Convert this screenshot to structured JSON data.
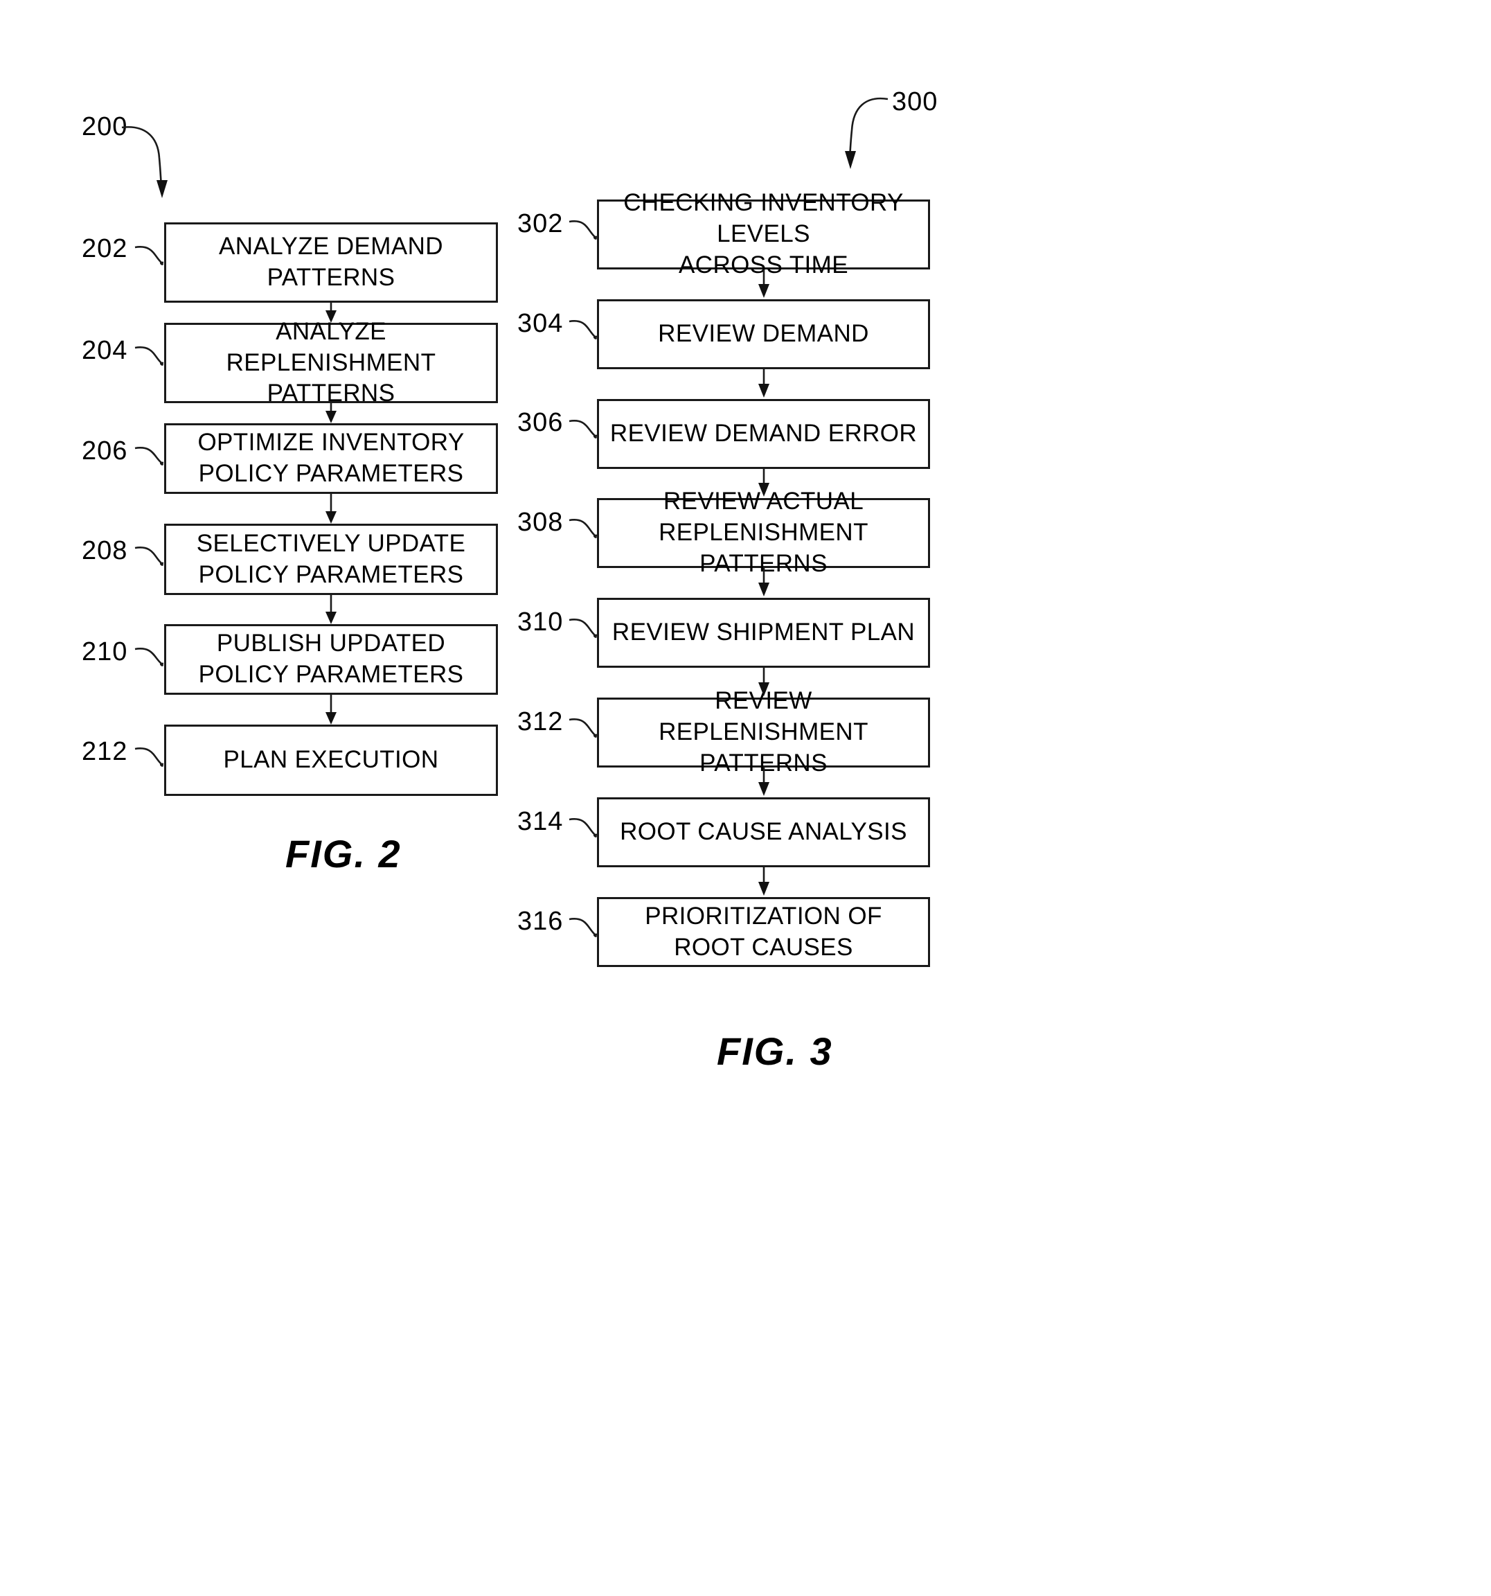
{
  "figures": [
    {
      "id": "fig2",
      "caption": "FIG. 2",
      "flow_ref": "200",
      "steps": [
        {
          "ref": "202",
          "label": "ANALYZE DEMAND PATTERNS"
        },
        {
          "ref": "204",
          "label": "ANALYZE REPLENISHMENT\nPATTERNS"
        },
        {
          "ref": "206",
          "label": "OPTIMIZE INVENTORY\nPOLICY PARAMETERS"
        },
        {
          "ref": "208",
          "label": "SELECTIVELY UPDATE\nPOLICY PARAMETERS"
        },
        {
          "ref": "210",
          "label": "PUBLISH UPDATED\nPOLICY PARAMETERS"
        },
        {
          "ref": "212",
          "label": "PLAN EXECUTION"
        }
      ]
    },
    {
      "id": "fig3",
      "caption": "FIG. 3",
      "flow_ref": "300",
      "steps": [
        {
          "ref": "302",
          "label": "CHECKING INVENTORY LEVELS\nACROSS TIME"
        },
        {
          "ref": "304",
          "label": "REVIEW DEMAND"
        },
        {
          "ref": "306",
          "label": "REVIEW DEMAND ERROR"
        },
        {
          "ref": "308",
          "label": "REVIEW ACTUAL\nREPLENISHMENT PATTERNS"
        },
        {
          "ref": "310",
          "label": "REVIEW SHIPMENT PLAN"
        },
        {
          "ref": "312",
          "label": "REVIEW REPLENISHMENT\nPATTERNS"
        },
        {
          "ref": "314",
          "label": "ROOT CAUSE ANALYSIS"
        },
        {
          "ref": "316",
          "label": "PRIORITIZATION OF\nROOT CAUSES"
        }
      ]
    }
  ],
  "colors": {
    "ink": "#1a1a1a",
    "paper": "#ffffff"
  }
}
